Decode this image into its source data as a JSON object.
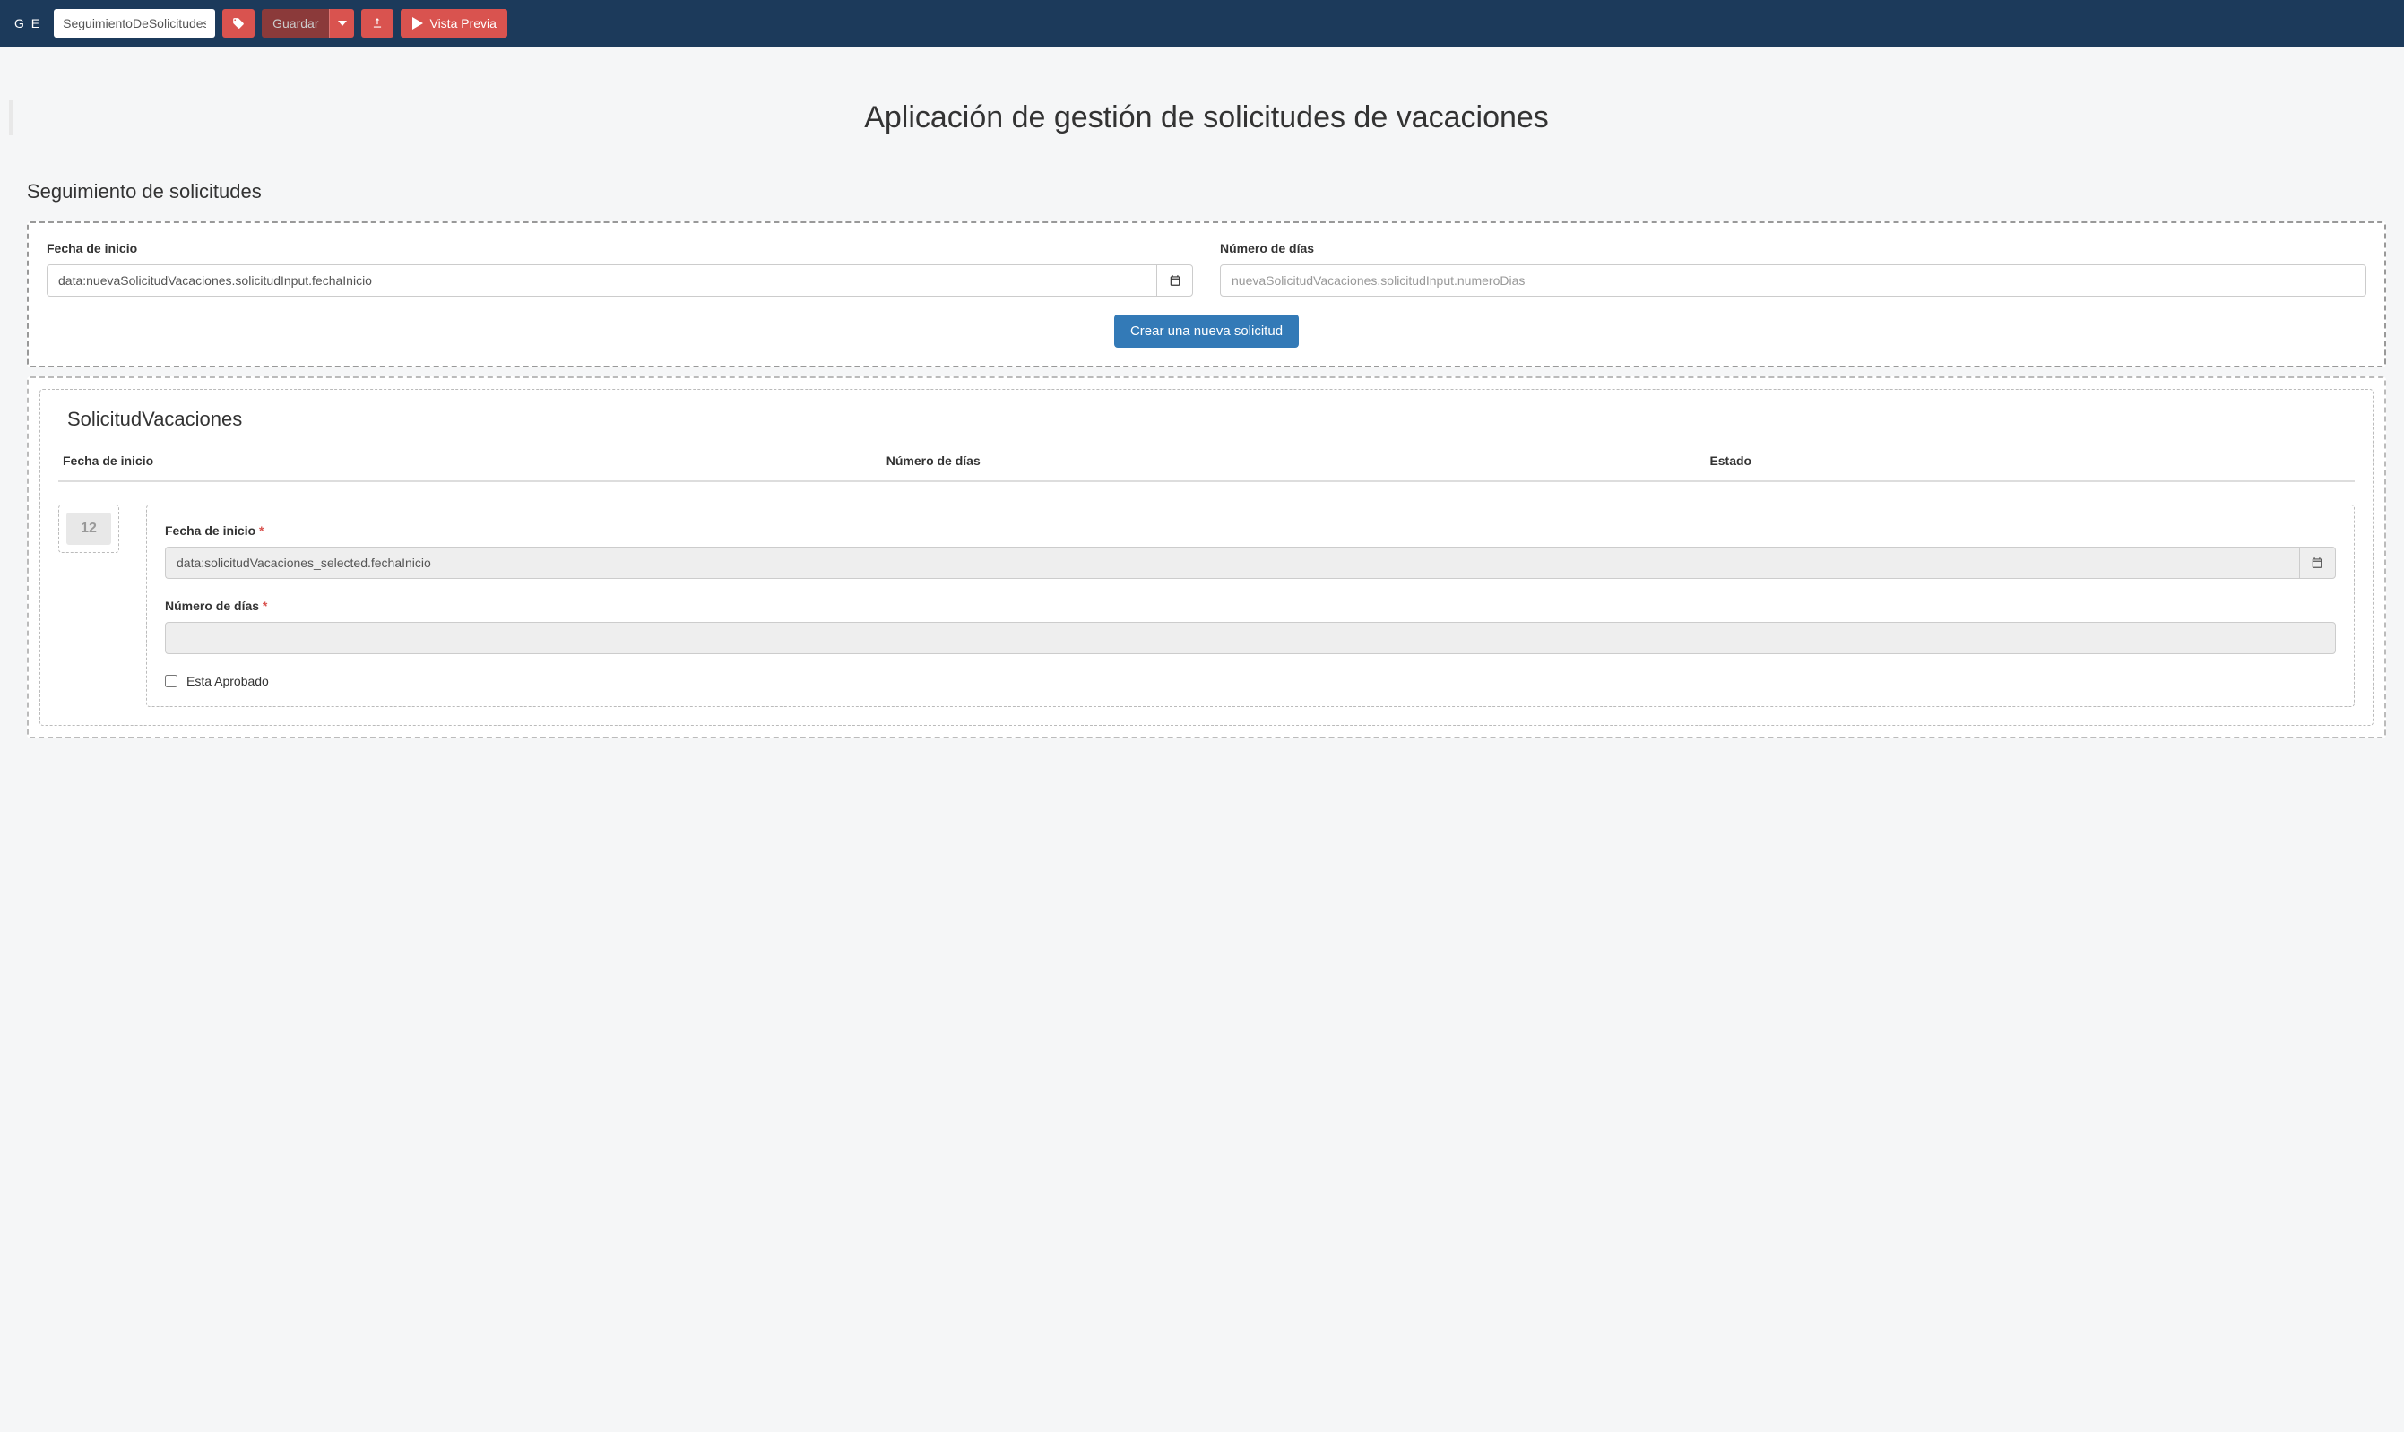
{
  "topbar": {
    "logo_suffix": "G E",
    "page_name_value": "SeguimientoDeSolicitudes",
    "save_label": "Guardar",
    "preview_label": "Vista Previa"
  },
  "page": {
    "title": "Aplicación de gestión de solicitudes de vacaciones",
    "section_title": "Seguimiento de solicitudes"
  },
  "form1": {
    "fecha_label": "Fecha de inicio",
    "fecha_value": "data:nuevaSolicitudVacaciones.solicitudInput.fechaInicio",
    "dias_label": "Número de días",
    "dias_placeholder": "nuevaSolicitudVacaciones.solicitudInput.numeroDias",
    "create_button": "Crear una nueva solicitud"
  },
  "list": {
    "title": "SolicitudVacaciones",
    "col_fecha": "Fecha de inicio",
    "col_dias": "Número de días",
    "col_estado": "Estado",
    "row_number": "12"
  },
  "detail": {
    "fecha_label": "Fecha de inicio",
    "fecha_value": "data:solicitudVacaciones_selected.fechaInicio",
    "dias_label": "Número de días",
    "aprobado_label": "Esta Aprobado"
  }
}
